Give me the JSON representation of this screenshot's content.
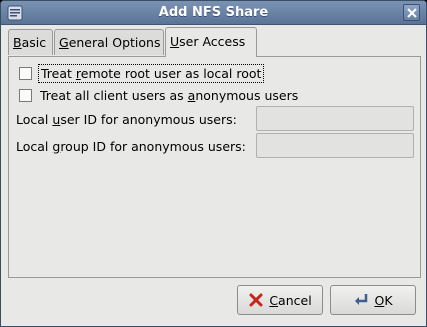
{
  "window": {
    "title": "Add NFS Share"
  },
  "tabs": [
    {
      "label_pre": "",
      "mnemonic": "B",
      "label_post": "asic",
      "active": false
    },
    {
      "label_pre": "",
      "mnemonic": "G",
      "label_post": "eneral Options",
      "active": false
    },
    {
      "label_pre": "",
      "mnemonic": "U",
      "label_post": "ser Access",
      "active": true
    }
  ],
  "options": {
    "root_squash": {
      "pre": "Treat ",
      "mnemonic": "r",
      "post": "emote root user as local root",
      "checked": false
    },
    "all_squash": {
      "pre": "Treat all client users as ",
      "mnemonic": "a",
      "post": "nonymous users",
      "checked": false
    }
  },
  "fields": {
    "anon_uid": {
      "pre": "Local ",
      "mnemonic": "u",
      "post": "ser ID for anonymous users:",
      "value": ""
    },
    "anon_gid": {
      "pre": "Local ",
      "mnemonic": "g",
      "post": "roup ID for anonymous users:",
      "value": ""
    }
  },
  "buttons": {
    "cancel": {
      "mnemonic": "C",
      "post": "ancel"
    },
    "ok": {
      "mnemonic": "O",
      "post": "K"
    }
  },
  "colors": {
    "titlebar": "#6a84a8",
    "window_bg": "#e8e8e7"
  }
}
